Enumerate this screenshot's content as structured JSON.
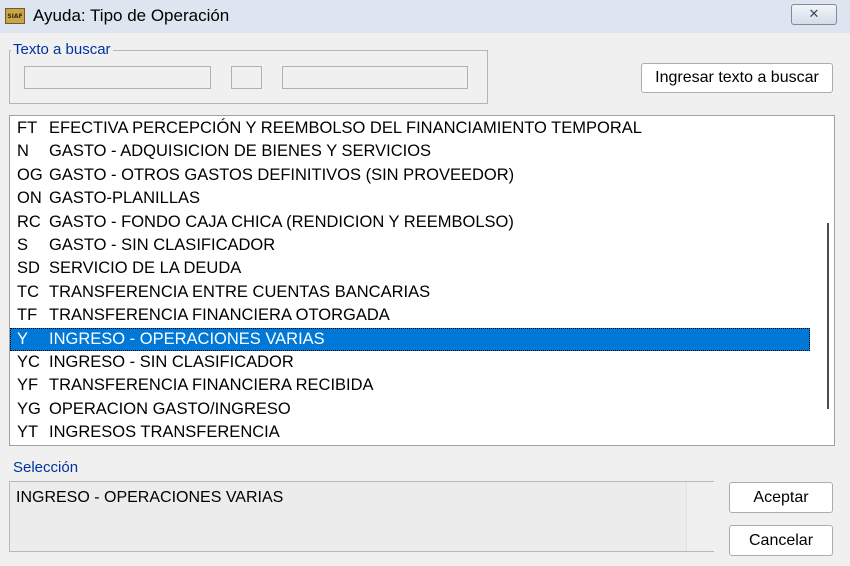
{
  "window": {
    "title": "Ayuda: Tipo de Operación",
    "app_icon_label": "SIAF",
    "close_symbol": "✕"
  },
  "search": {
    "group_label": "Texto a buscar",
    "field1_value": "",
    "field2_value": "",
    "field3_value": "",
    "button_label": "Ingresar texto a buscar"
  },
  "list": {
    "selected_index": 9,
    "items": [
      {
        "code": "FT",
        "desc": "EFECTIVA PERCEPCIÓN Y REEMBOLSO DEL FINANCIAMIENTO TEMPORAL"
      },
      {
        "code": "N",
        "desc": "GASTO - ADQUISICION DE BIENES Y SERVICIOS"
      },
      {
        "code": "OG",
        "desc": "GASTO - OTROS GASTOS DEFINITIVOS (SIN PROVEEDOR)"
      },
      {
        "code": "ON",
        "desc": "GASTO-PLANILLAS"
      },
      {
        "code": "RC",
        "desc": "GASTO - FONDO CAJA CHICA (RENDICION Y REEMBOLSO)"
      },
      {
        "code": "S",
        "desc": "GASTO - SIN CLASIFICADOR"
      },
      {
        "code": "SD",
        "desc": "SERVICIO DE LA DEUDA"
      },
      {
        "code": "TC",
        "desc": "TRANSFERENCIA ENTRE CUENTAS BANCARIAS"
      },
      {
        "code": "TF",
        "desc": "TRANSFERENCIA FINANCIERA OTORGADA"
      },
      {
        "code": "Y",
        "desc": "INGRESO - OPERACIONES VARIAS"
      },
      {
        "code": "YC",
        "desc": "INGRESO - SIN CLASIFICADOR"
      },
      {
        "code": "YF",
        "desc": "TRANSFERENCIA FINANCIERA RECIBIDA"
      },
      {
        "code": "YG",
        "desc": "OPERACION GASTO/INGRESO"
      },
      {
        "code": "YT",
        "desc": "INGRESOS TRANSFERENCIA"
      }
    ]
  },
  "selection": {
    "label": "Selección",
    "value": "INGRESO - OPERACIONES VARIAS"
  },
  "buttons": {
    "accept": "Aceptar",
    "cancel": "Cancelar"
  },
  "colors": {
    "selected_row": "#0078d7",
    "group_label": "#0033a0"
  }
}
